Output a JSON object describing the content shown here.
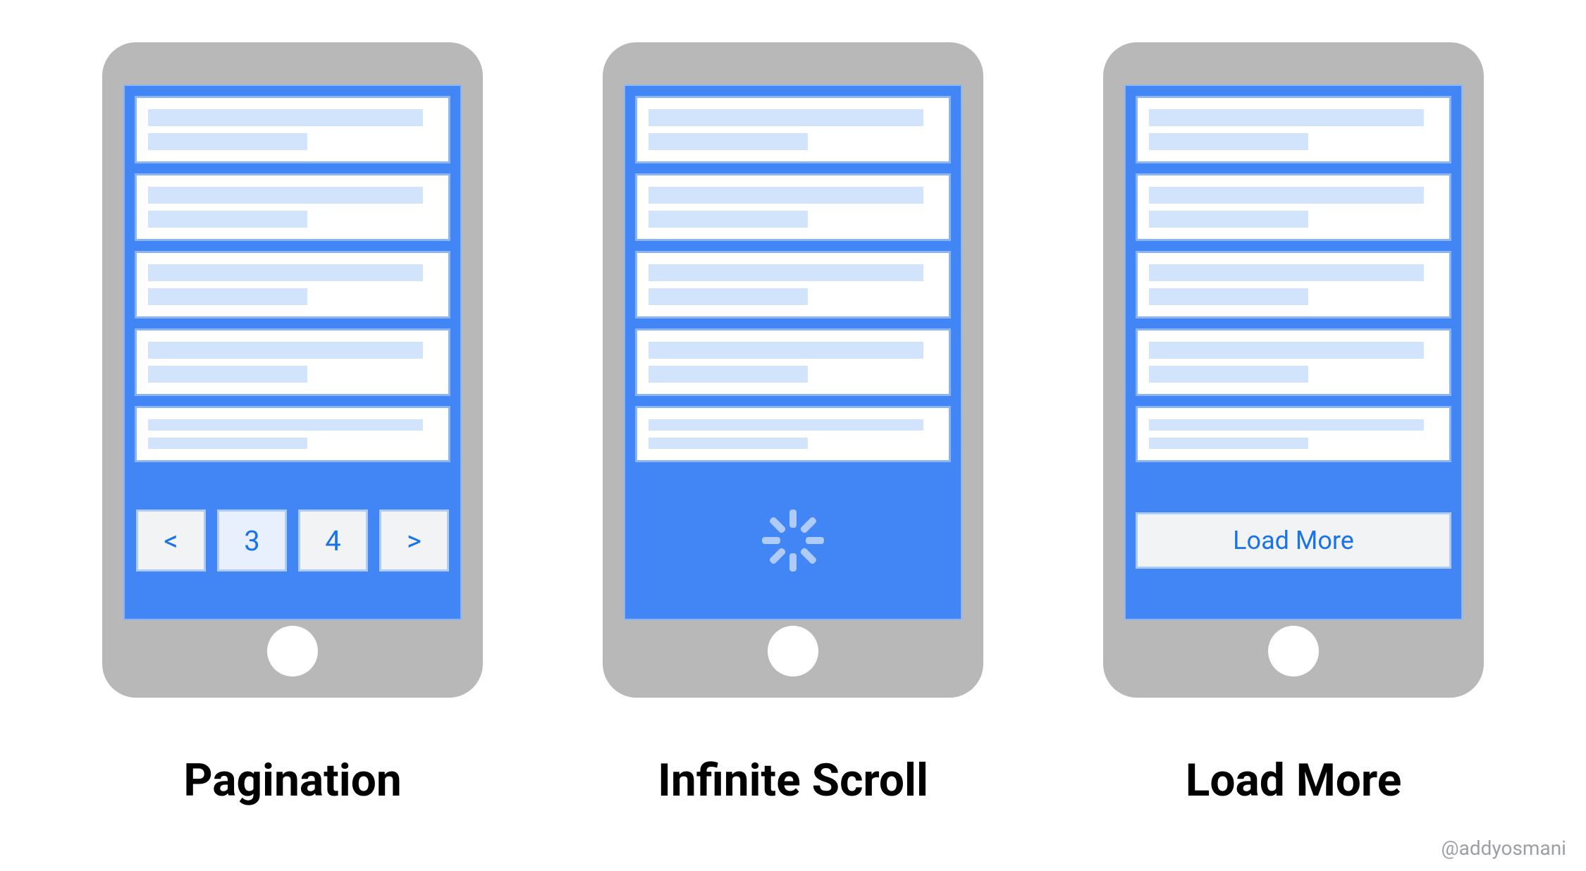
{
  "patterns": [
    {
      "label": "Pagination"
    },
    {
      "label": "Infinite Scroll"
    },
    {
      "label": "Load More"
    }
  ],
  "pagination": {
    "prev": "<",
    "pages": [
      "3",
      "4"
    ],
    "next": ">",
    "active_page": "3"
  },
  "load_more": {
    "button_label": "Load More"
  },
  "attribution": "@addyosmani"
}
